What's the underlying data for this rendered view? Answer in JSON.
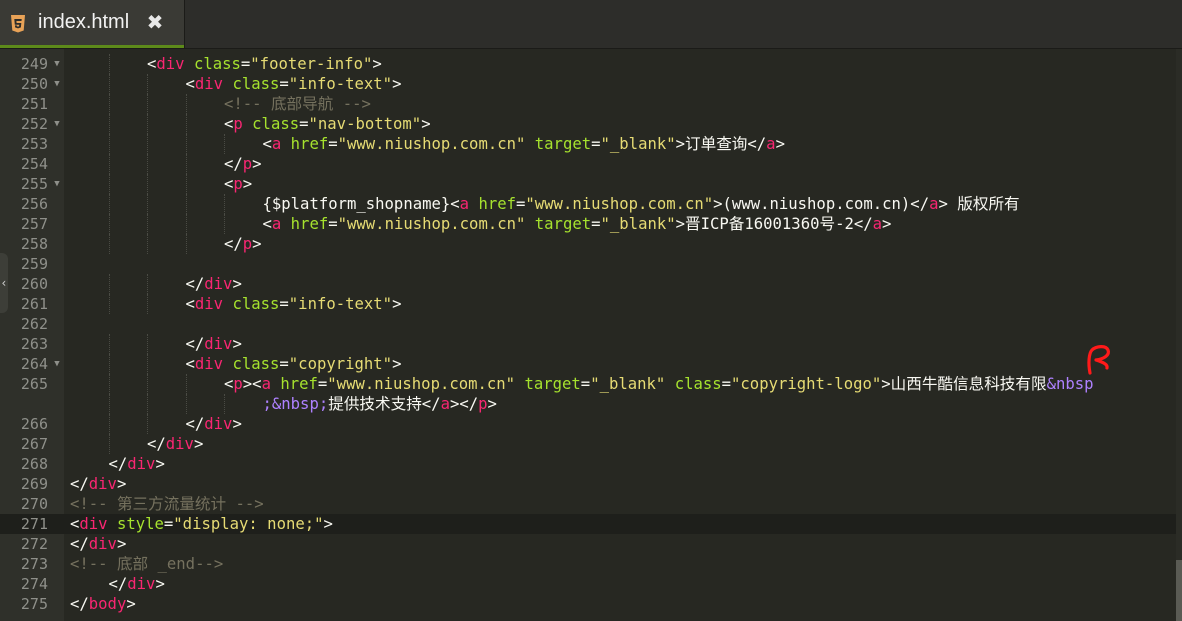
{
  "tab": {
    "title": "index.html",
    "close_glyph": "✖",
    "icon": "html5-icon"
  },
  "colors": {
    "background": "#272822",
    "tag": "#f92672",
    "attribute": "#a6e22e",
    "string": "#e6db74",
    "comment": "#75715e",
    "entity": "#ae81ff",
    "text": "#f8f8f2",
    "line_number": "#8f908a"
  },
  "active_line": "271",
  "lines": [
    {
      "num": "249",
      "fold": true,
      "indent": 2,
      "tokens": [
        [
          "t",
          "<"
        ],
        [
          "g",
          "div"
        ],
        [
          "t",
          " "
        ],
        [
          "a",
          "class"
        ],
        [
          "t",
          "="
        ],
        [
          "s",
          "\"footer-info\""
        ],
        [
          "t",
          ">"
        ]
      ]
    },
    {
      "num": "250",
      "fold": true,
      "indent": 3,
      "tokens": [
        [
          "t",
          "<"
        ],
        [
          "g",
          "div"
        ],
        [
          "t",
          " "
        ],
        [
          "a",
          "class"
        ],
        [
          "t",
          "="
        ],
        [
          "s",
          "\"info-text\""
        ],
        [
          "t",
          ">"
        ]
      ]
    },
    {
      "num": "251",
      "fold": false,
      "indent": 4,
      "tokens": [
        [
          "c",
          "<!-- 底部导航 -->"
        ]
      ]
    },
    {
      "num": "252",
      "fold": true,
      "indent": 4,
      "tokens": [
        [
          "t",
          "<"
        ],
        [
          "g",
          "p"
        ],
        [
          "t",
          " "
        ],
        [
          "a",
          "class"
        ],
        [
          "t",
          "="
        ],
        [
          "s",
          "\"nav-bottom\""
        ],
        [
          "t",
          ">"
        ]
      ]
    },
    {
      "num": "253",
      "fold": false,
      "indent": 5,
      "tokens": [
        [
          "t",
          "<"
        ],
        [
          "g",
          "a"
        ],
        [
          "t",
          " "
        ],
        [
          "a",
          "href"
        ],
        [
          "t",
          "="
        ],
        [
          "s",
          "\"www.niushop.com.cn\""
        ],
        [
          "t",
          " "
        ],
        [
          "a",
          "target"
        ],
        [
          "t",
          "="
        ],
        [
          "s",
          "\"_blank\""
        ],
        [
          "t",
          ">订单查询</"
        ],
        [
          "g",
          "a"
        ],
        [
          "t",
          ">"
        ]
      ]
    },
    {
      "num": "254",
      "fold": false,
      "indent": 4,
      "tokens": [
        [
          "t",
          "</"
        ],
        [
          "g",
          "p"
        ],
        [
          "t",
          ">"
        ]
      ]
    },
    {
      "num": "255",
      "fold": true,
      "indent": 4,
      "tokens": [
        [
          "t",
          "<"
        ],
        [
          "g",
          "p"
        ],
        [
          "t",
          ">"
        ]
      ]
    },
    {
      "num": "256",
      "fold": false,
      "indent": 5,
      "tokens": [
        [
          "t",
          "{$platform_shopname}<"
        ],
        [
          "g",
          "a"
        ],
        [
          "t",
          " "
        ],
        [
          "a",
          "href"
        ],
        [
          "t",
          "="
        ],
        [
          "s",
          "\"www.niushop.com.cn\""
        ],
        [
          "t",
          ">(www.niushop.com.cn)</"
        ],
        [
          "g",
          "a"
        ],
        [
          "t",
          "> 版权所有"
        ]
      ]
    },
    {
      "num": "257",
      "fold": false,
      "indent": 5,
      "tokens": [
        [
          "t",
          "<"
        ],
        [
          "g",
          "a"
        ],
        [
          "t",
          " "
        ],
        [
          "a",
          "href"
        ],
        [
          "t",
          "="
        ],
        [
          "s",
          "\"www.niushop.com.cn\""
        ],
        [
          "t",
          " "
        ],
        [
          "a",
          "target"
        ],
        [
          "t",
          "="
        ],
        [
          "s",
          "\"_blank\""
        ],
        [
          "t",
          ">晋ICP备16001360号-2</"
        ],
        [
          "g",
          "a"
        ],
        [
          "t",
          ">"
        ]
      ]
    },
    {
      "num": "258",
      "fold": false,
      "indent": 4,
      "tokens": [
        [
          "t",
          "</"
        ],
        [
          "g",
          "p"
        ],
        [
          "t",
          ">"
        ]
      ]
    },
    {
      "num": "259",
      "fold": false,
      "indent": 0,
      "tokens": []
    },
    {
      "num": "260",
      "fold": false,
      "indent": 3,
      "tokens": [
        [
          "t",
          "</"
        ],
        [
          "g",
          "div"
        ],
        [
          "t",
          ">"
        ]
      ]
    },
    {
      "num": "261",
      "fold": false,
      "indent": 3,
      "tokens": [
        [
          "t",
          "<"
        ],
        [
          "g",
          "div"
        ],
        [
          "t",
          " "
        ],
        [
          "a",
          "class"
        ],
        [
          "t",
          "="
        ],
        [
          "s",
          "\"info-text\""
        ],
        [
          "t",
          ">"
        ]
      ]
    },
    {
      "num": "262",
      "fold": false,
      "indent": 0,
      "tokens": []
    },
    {
      "num": "263",
      "fold": false,
      "indent": 3,
      "tokens": [
        [
          "t",
          "</"
        ],
        [
          "g",
          "div"
        ],
        [
          "t",
          ">"
        ]
      ]
    },
    {
      "num": "264",
      "fold": true,
      "indent": 3,
      "tokens": [
        [
          "t",
          "<"
        ],
        [
          "g",
          "div"
        ],
        [
          "t",
          " "
        ],
        [
          "a",
          "class"
        ],
        [
          "t",
          "="
        ],
        [
          "s",
          "\"copyright\""
        ],
        [
          "t",
          ">"
        ]
      ]
    },
    {
      "num": "265",
      "fold": false,
      "indent": 4,
      "tokens": [
        [
          "t",
          "<"
        ],
        [
          "g",
          "p"
        ],
        [
          "t",
          "><"
        ],
        [
          "g",
          "a"
        ],
        [
          "t",
          " "
        ],
        [
          "a",
          "href"
        ],
        [
          "t",
          "="
        ],
        [
          "s",
          "\"www.niushop.com.cn\""
        ],
        [
          "t",
          " "
        ],
        [
          "a",
          "target"
        ],
        [
          "t",
          "="
        ],
        [
          "s",
          "\"_blank\""
        ],
        [
          "t",
          " "
        ],
        [
          "a",
          "class"
        ],
        [
          "t",
          "="
        ],
        [
          "s",
          "\"copyright-logo\""
        ],
        [
          "t",
          ">山西牛酷信息科技有限"
        ],
        [
          "e",
          "&nbsp"
        ]
      ]
    },
    {
      "num": "",
      "fold": false,
      "indent": 5,
      "tokens": [
        [
          "e",
          ";&nbsp;"
        ],
        [
          "t",
          "提供技术支持</"
        ],
        [
          "g",
          "a"
        ],
        [
          "t",
          "></"
        ],
        [
          "g",
          "p"
        ],
        [
          "t",
          ">"
        ]
      ]
    },
    {
      "num": "266",
      "fold": false,
      "indent": 3,
      "tokens": [
        [
          "t",
          "</"
        ],
        [
          "g",
          "div"
        ],
        [
          "t",
          ">"
        ]
      ]
    },
    {
      "num": "267",
      "fold": false,
      "indent": 2,
      "tokens": [
        [
          "t",
          "</"
        ],
        [
          "g",
          "div"
        ],
        [
          "t",
          ">"
        ]
      ]
    },
    {
      "num": "268",
      "fold": false,
      "indent": 1,
      "tokens": [
        [
          "t",
          "</"
        ],
        [
          "g",
          "div"
        ],
        [
          "t",
          ">"
        ]
      ]
    },
    {
      "num": "269",
      "fold": false,
      "indent": 0,
      "tokens": [
        [
          "t",
          "</"
        ],
        [
          "g",
          "div"
        ],
        [
          "t",
          ">"
        ]
      ]
    },
    {
      "num": "270",
      "fold": false,
      "indent": 0,
      "tokens": [
        [
          "c",
          "<!-- 第三方流量统计 -->"
        ]
      ]
    },
    {
      "num": "271",
      "fold": false,
      "indent": 0,
      "tokens": [
        [
          "t",
          "<"
        ],
        [
          "g",
          "div"
        ],
        [
          "t",
          " "
        ],
        [
          "a",
          "style"
        ],
        [
          "t",
          "="
        ],
        [
          "s",
          "\"display: none;\""
        ],
        [
          "t",
          ">"
        ]
      ]
    },
    {
      "num": "272",
      "fold": false,
      "indent": 0,
      "tokens": [
        [
          "t",
          "</"
        ],
        [
          "g",
          "div"
        ],
        [
          "t",
          ">"
        ]
      ]
    },
    {
      "num": "273",
      "fold": false,
      "indent": 0,
      "tokens": [
        [
          "c",
          "<!-- 底部 _end-->"
        ]
      ]
    },
    {
      "num": "274",
      "fold": false,
      "indent": 1,
      "tokens": [
        [
          "t",
          "</"
        ],
        [
          "g",
          "div"
        ],
        [
          "t",
          ">"
        ]
      ]
    },
    {
      "num": "275",
      "fold": false,
      "indent": 0,
      "tokens": [
        [
          "t",
          "</"
        ],
        [
          "g",
          "body"
        ],
        [
          "t",
          ">"
        ]
      ]
    }
  ]
}
